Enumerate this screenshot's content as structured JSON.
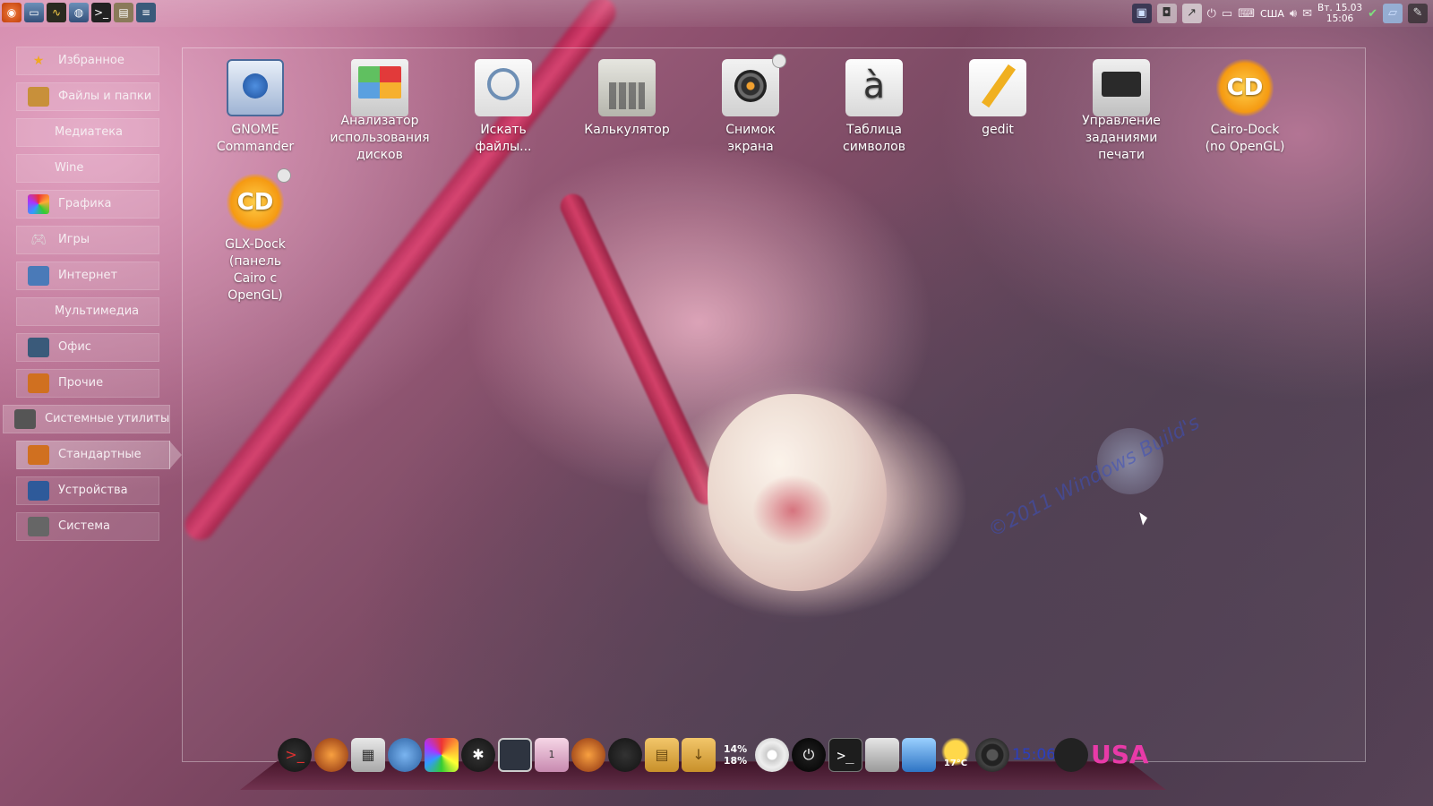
{
  "top_panel": {
    "launchers": [
      "ubuntu-icon",
      "files-icon",
      "system-monitor-icon",
      "browser-icon",
      "terminal-icon",
      "archive-icon",
      "sysinfo-icon"
    ],
    "tray": {
      "keyboard_layout": "США",
      "clock_date": "Вт. 15.03",
      "clock_time": "15:06"
    }
  },
  "menu": {
    "items": [
      {
        "label": "Избранное",
        "icon": "star-icon"
      },
      {
        "label": "Файлы и папки",
        "icon": "folder-icon"
      },
      {
        "label": "Медиатека",
        "icon": ""
      },
      {
        "label": "Wine",
        "icon": ""
      },
      {
        "label": "Графика",
        "icon": "graphics-icon"
      },
      {
        "label": "Игры",
        "icon": "gamepad-icon"
      },
      {
        "label": "Интернет",
        "icon": "internet-icon"
      },
      {
        "label": "Мультимедиа",
        "icon": ""
      },
      {
        "label": "Офис",
        "icon": "office-icon"
      },
      {
        "label": "Прочие",
        "icon": "misc-icon"
      },
      {
        "label": "Системные утилиты",
        "icon": "system-tools-icon"
      },
      {
        "label": "Стандартные",
        "icon": "accessories-icon"
      },
      {
        "label": "Устройства",
        "icon": "devices-icon"
      },
      {
        "label": "Система",
        "icon": "system-icon"
      }
    ]
  },
  "desktop": {
    "icons": [
      {
        "label": "GNOME\nCommander",
        "icon": "gnome-commander-icon"
      },
      {
        "label": "Анализатор\nиспользования\nдисков",
        "icon": "disk-usage-icon"
      },
      {
        "label": "Искать\nфайлы...",
        "icon": "search-files-icon"
      },
      {
        "label": "Калькулятор",
        "icon": "calculator-icon"
      },
      {
        "label": "Снимок\nэкрана",
        "icon": "screenshot-icon"
      },
      {
        "label": "Таблица\nсимволов",
        "icon": "character-map-icon"
      },
      {
        "label": "gedit",
        "icon": "gedit-icon"
      },
      {
        "label": "Управление\nзаданиями\nпечати",
        "icon": "print-jobs-icon"
      },
      {
        "label": "Cairo-Dock\n(no OpenGL)",
        "icon": "cairo-dock-icon"
      },
      {
        "label": "GLX-Dock\n(панель\nCairo с\nOpenGL)",
        "icon": "glx-dock-icon"
      }
    ],
    "char_map_glyph": "à",
    "cairo_logo": "CD",
    "watermark": "©2011 Windows Build's"
  },
  "dock": {
    "cpu": "14%",
    "ram": "18%",
    "weather": "17°C",
    "clock": "15:06",
    "layout": "USA",
    "workspace": "1"
  }
}
